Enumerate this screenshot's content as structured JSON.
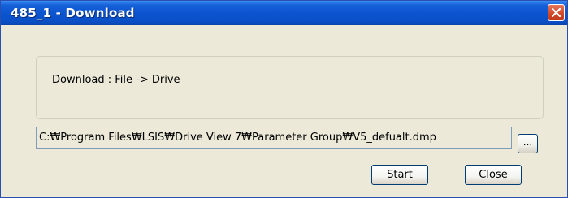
{
  "window": {
    "title": "485_1 - Download"
  },
  "group": {
    "text": "Download : File -> Drive"
  },
  "path": {
    "value": "C:₩Program Files₩LSIS₩Drive View 7₩Parameter Group₩V5_defualt.dmp"
  },
  "buttons": {
    "browse": "...",
    "start": "Start",
    "close": "Close"
  },
  "icons": {
    "close": "close-icon"
  },
  "colors": {
    "titlebar": "#0b55d0",
    "close_button": "#d24a2a",
    "dialog_bg": "#ece9d8"
  }
}
